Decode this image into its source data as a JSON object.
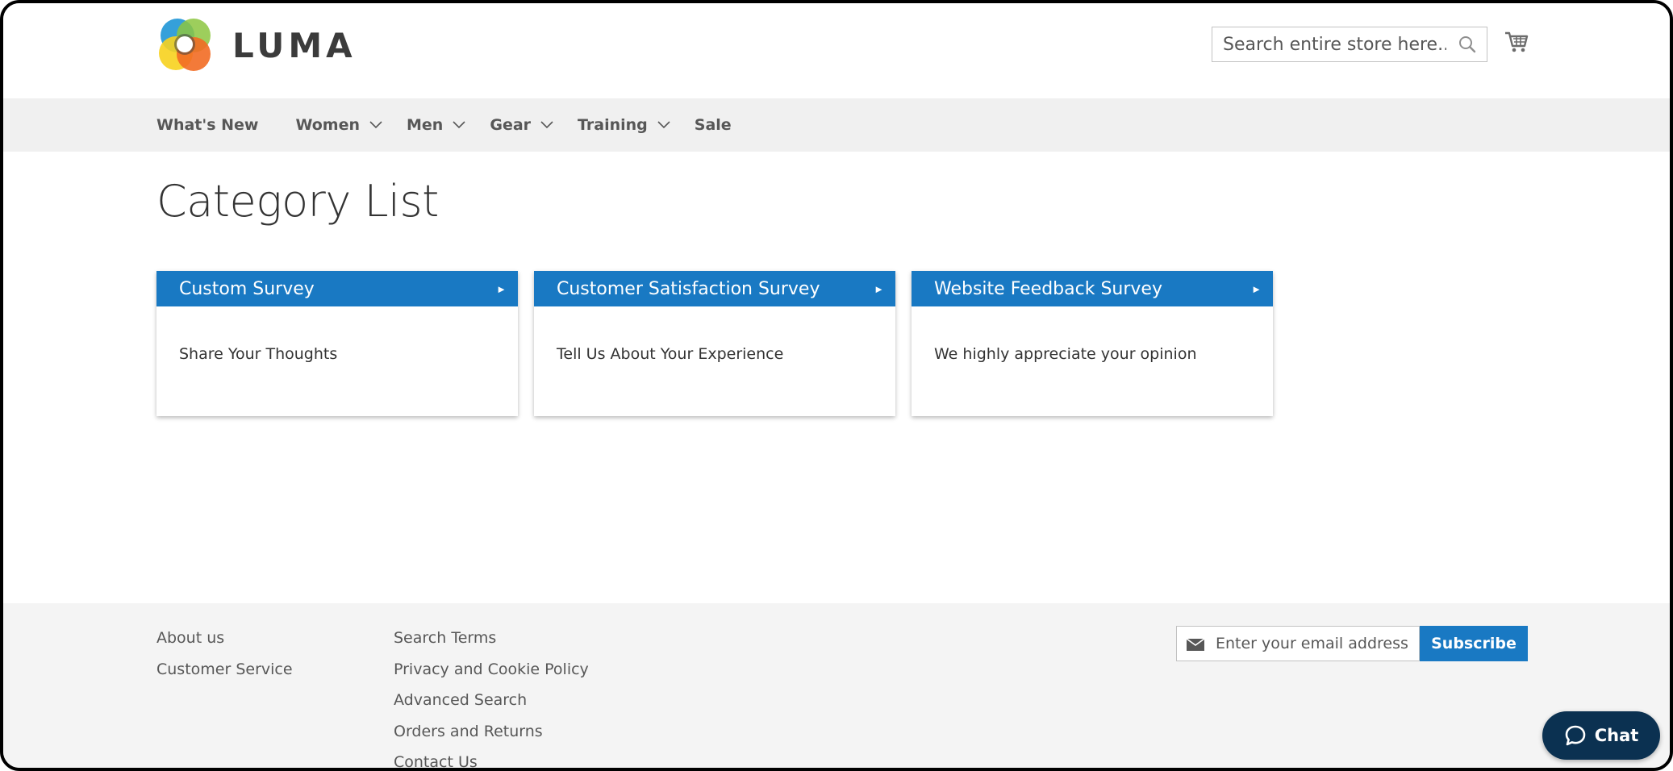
{
  "header": {
    "logo_text": "LUMA",
    "search": {
      "placeholder": "Search entire store here..."
    }
  },
  "nav": {
    "items": [
      {
        "label": "What's New",
        "has_submenu": false
      },
      {
        "label": "Women",
        "has_submenu": true
      },
      {
        "label": "Men",
        "has_submenu": true
      },
      {
        "label": "Gear",
        "has_submenu": true
      },
      {
        "label": "Training",
        "has_submenu": true
      },
      {
        "label": "Sale",
        "has_submenu": false
      }
    ]
  },
  "main": {
    "title": "Category List",
    "cards": [
      {
        "title": "Custom Survey",
        "description": "Share Your Thoughts"
      },
      {
        "title": "Customer Satisfaction Survey",
        "description": "Tell Us About Your Experience"
      },
      {
        "title": "Website Feedback Survey",
        "description": "We highly appreciate your opinion"
      }
    ],
    "arrow_glyph": "►"
  },
  "footer": {
    "col1": [
      "About us",
      "Customer Service"
    ],
    "col2": [
      "Search Terms",
      "Privacy and Cookie Policy",
      "Advanced Search",
      "Orders and Returns",
      "Contact Us"
    ],
    "newsletter": {
      "placeholder": "Enter your email address",
      "button_label": "Subscribe"
    }
  },
  "chat": {
    "label": "Chat"
  },
  "colors": {
    "accent": "#1979c3",
    "nav_bg": "#f0f0f0",
    "footer_bg": "#f4f4f4",
    "chat_bg": "#0b3151"
  },
  "icons": {
    "logo": "luma-logo-icon",
    "search": "search-icon",
    "cart": "cart-icon",
    "chevron": "chevron-down-icon",
    "mail": "mail-icon",
    "chat": "chat-bubble-icon"
  }
}
